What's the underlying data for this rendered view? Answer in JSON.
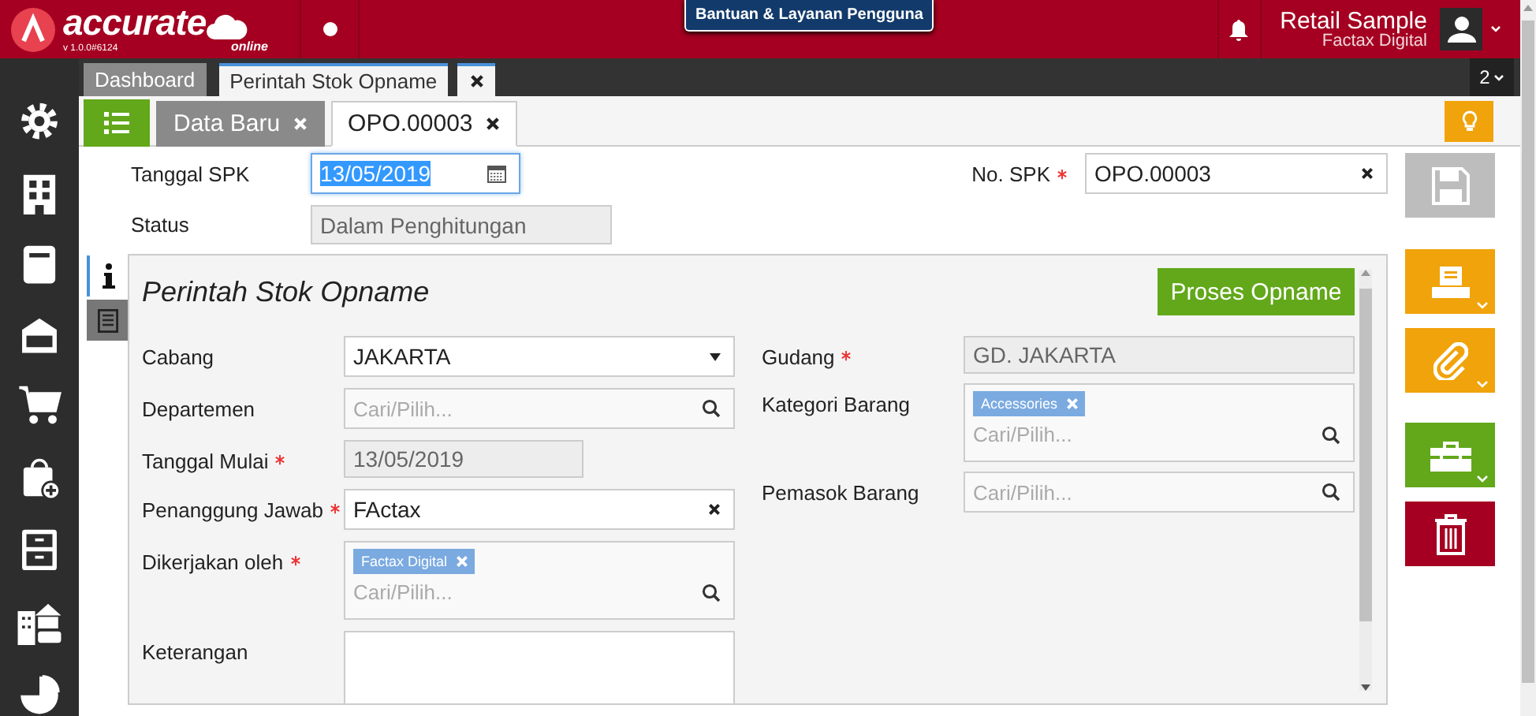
{
  "app": {
    "logo_text": "accurate",
    "logo_sub": "online",
    "version": "v 1.0.0#6124",
    "help_button": "Bantuan & Layanan Pengguna",
    "company": "Retail Sample",
    "user": "Factax Digital"
  },
  "window_tabs": [
    {
      "label": "Dashboard",
      "selected": false
    },
    {
      "label": "Perintah Stok Opname",
      "selected": true
    }
  ],
  "tab_count": "2",
  "doc_tabs": [
    {
      "label": "Data Baru",
      "selected": false
    },
    {
      "label": "OPO.00003",
      "selected": true
    }
  ],
  "header_fields": [
    {
      "label": "Tanggal SPK",
      "kind": "date",
      "value": "13/05/2019",
      "focused": true
    },
    {
      "label": "Status",
      "kind": "readonly",
      "value": "Dalam Penghitungan"
    }
  ],
  "no_spk": {
    "label": "No. SPK",
    "kind": "clearable",
    "value": "OPO.00003",
    "required": true
  },
  "panel": {
    "side_tabs": [
      {
        "selected": true
      },
      {
        "selected": false
      }
    ],
    "title": "Perintah Stok Opname",
    "action_button": "Proses Opname",
    "left_fields": [
      {
        "label": "Cabang",
        "kind": "select",
        "value": "JAKARTA",
        "required": false
      },
      {
        "label": "Departemen",
        "kind": "search",
        "placeholder": "Cari/Pilih...",
        "required": false
      },
      {
        "label": "Tanggal Mulai",
        "kind": "readonly_date",
        "value": "13/05/2019",
        "required": true
      },
      {
        "label": "Penanggung Jawab",
        "kind": "clearable",
        "value": "FActax",
        "required": true
      },
      {
        "label": "Dikerjakan oleh",
        "kind": "multi",
        "tags": [
          "Factax Digital"
        ],
        "placeholder": "Cari/Pilih...",
        "required": true
      },
      {
        "label": "Keterangan",
        "kind": "textarea",
        "required": false
      }
    ],
    "right_fields": [
      {
        "label": "Gudang",
        "kind": "readonly",
        "value": "GD. JAKARTA",
        "required": true
      },
      {
        "label": "Kategori Barang",
        "kind": "multi",
        "tags": [
          "Accessories"
        ],
        "placeholder": "Cari/Pilih...",
        "required": false
      },
      {
        "label": "Pemasok Barang",
        "kind": "search",
        "placeholder": "Cari/Pilih...",
        "required": false
      }
    ]
  }
}
